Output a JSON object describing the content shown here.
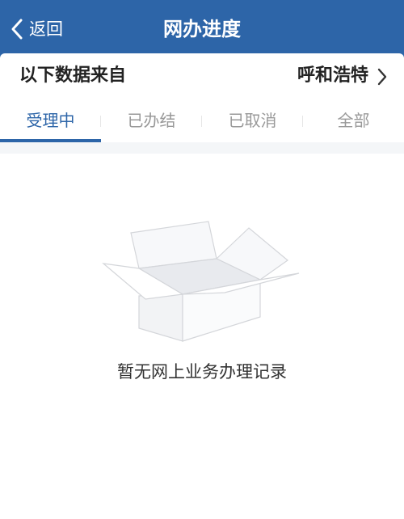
{
  "header": {
    "back_label": "返回",
    "title": "网办进度"
  },
  "source": {
    "label": "以下数据来自",
    "city": "呼和浩特"
  },
  "tabs": [
    {
      "label": "受理中",
      "active": true
    },
    {
      "label": "已办结",
      "active": false
    },
    {
      "label": "已取消",
      "active": false
    },
    {
      "label": "全部",
      "active": false
    }
  ],
  "empty_state": {
    "message": "暂无网上业务办理记录",
    "icon": "empty-box-icon"
  },
  "colors": {
    "accent": "#2d65a8",
    "inactive_tab": "#999999",
    "text": "#222222"
  }
}
